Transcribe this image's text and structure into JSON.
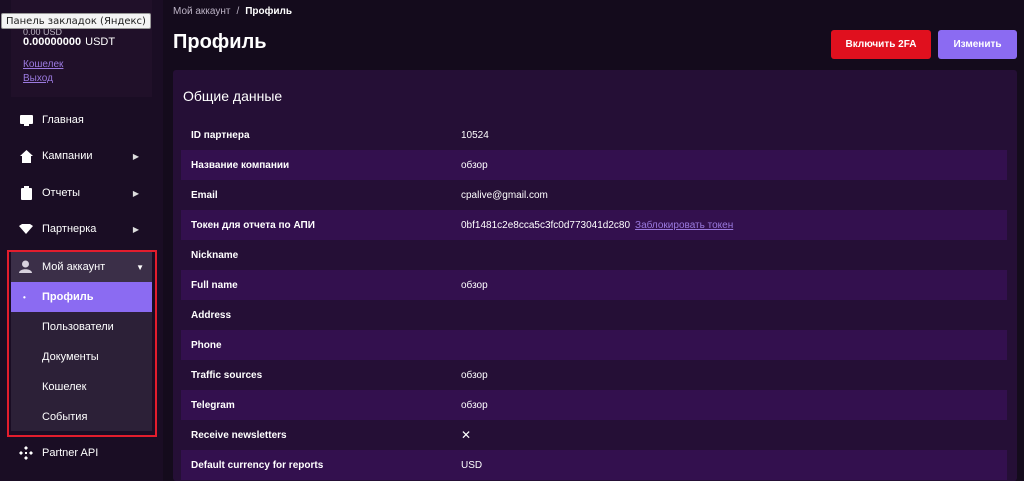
{
  "sidebar": {
    "tooltip": "Панель закладок (Яндекс)",
    "partial_line": "0.00 USD",
    "balance_amount": "0.00000000",
    "balance_currency": "USDT",
    "wallet_link": "Кошелек",
    "logout_link": "Выход",
    "items": [
      {
        "label": "Главная",
        "icon": "monitor-icon"
      },
      {
        "label": "Кампании",
        "icon": "home-icon"
      },
      {
        "label": "Отчеты",
        "icon": "clipboard-icon"
      },
      {
        "label": "Партнерка",
        "icon": "diamond-icon"
      }
    ],
    "account": {
      "label": "Мой аккаунт",
      "icon": "user-icon",
      "sub_items": [
        "Профиль",
        "Пользователи",
        "Документы",
        "Кошелек",
        "События"
      ],
      "active_index": 0
    },
    "partner_api": {
      "label": "Partner API",
      "icon": "api-icon"
    }
  },
  "header": {
    "breadcrumb_parent": "Мой аккаунт",
    "breadcrumb_sep": "/",
    "breadcrumb_current": "Профиль",
    "title": "Профиль",
    "btn_2fa": "Включить 2FA",
    "btn_edit": "Изменить"
  },
  "panel": {
    "title": "Общие данные",
    "rows": [
      {
        "label": "ID партнера",
        "value": "10524"
      },
      {
        "label": "Название компании",
        "value": "обзор"
      },
      {
        "label": "Email",
        "value": "cpalive@gmail.com"
      },
      {
        "label": "Токен для отчета по АПИ",
        "value": "0bf1481c2e8cca5c3fc0d773041d2c80",
        "link": "Заблокировать токен"
      },
      {
        "label": "Nickname",
        "value": ""
      },
      {
        "label": "Full name",
        "value": "обзор"
      },
      {
        "label": "Address",
        "value": ""
      },
      {
        "label": "Phone",
        "value": ""
      },
      {
        "label": "Traffic sources",
        "value": "обзор"
      },
      {
        "label": "Telegram",
        "value": "обзор"
      },
      {
        "label": "Receive newsletters",
        "value": "✕"
      },
      {
        "label": "Default currency for reports",
        "value": "USD"
      }
    ]
  },
  "colors": {
    "accent": "#8b6bf2",
    "danger": "#e0101e",
    "highlight_frame": "#e31d2d"
  }
}
